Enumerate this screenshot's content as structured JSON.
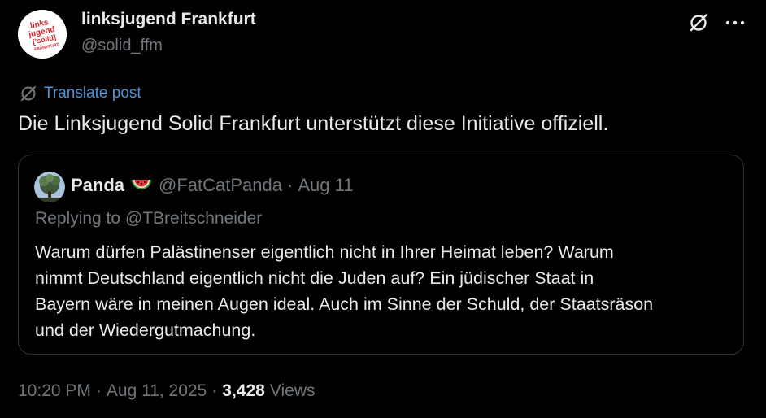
{
  "author": {
    "display_name": "linksjugend Frankfurt",
    "handle": "@solid_ffm",
    "avatar": {
      "logo_lines": [
        "links",
        "jugend",
        "['solid]",
        "FRANKFURT"
      ],
      "colors": {
        "background": "#ffffff",
        "brand": "#d8232a"
      }
    }
  },
  "header_actions": {
    "grok_icon": "grok-icon",
    "more_icon": "more-horizontal-icon"
  },
  "translate": {
    "icon": "translate-globe-icon",
    "label": "Translate post"
  },
  "tweet": {
    "text": "Die Linksjugend Solid Frankfurt unterstützt diese Initiative offiziell."
  },
  "quote": {
    "author_name": "Panda",
    "emoji": "watermelon",
    "handle": "@FatCatPanda",
    "separator": "·",
    "date": "Aug 11",
    "replying_to": "Replying to @TBreitschneider",
    "body_lines": [
      "Warum dürfen Palästinenser eigentlich nicht in Ihrer Heimat leben? Warum",
      "nimmt Deutschland eigentlich nicht die Juden auf? Ein jüdischer Staat in",
      "Bayern wäre in meinen Augen ideal. Auch im Sinne der Schuld, der Staatsräson",
      "und der Wiedergutmachung."
    ]
  },
  "meta": {
    "time": "10:20 PM",
    "separator": "·",
    "date": "Aug 11, 2025",
    "views_count": "3,428",
    "views_label": "Views"
  },
  "colors": {
    "background": "#000000",
    "text_primary": "#e7e9ea",
    "text_secondary": "#71767b",
    "link": "#4d94d8",
    "border": "#2f3336"
  }
}
